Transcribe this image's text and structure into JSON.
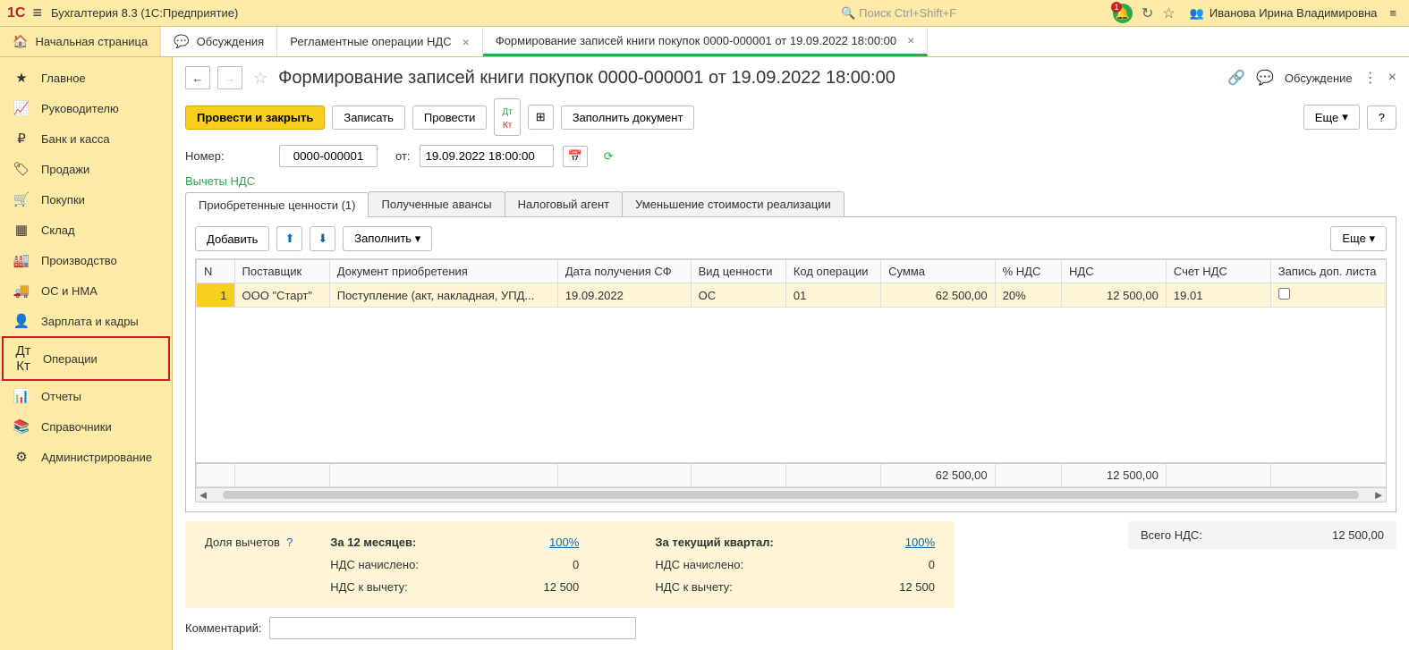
{
  "app": {
    "title": "Бухгалтерия 8.3  (1С:Предприятие)",
    "search_placeholder": "Поиск Ctrl+Shift+F",
    "notif_count": "1",
    "user_name": "Иванова Ирина Владимировна"
  },
  "tabs": {
    "home": "Начальная страница",
    "t1": "Обсуждения",
    "t2": "Регламентные операции НДС",
    "t3": "Формирование записей книги покупок 0000-000001 от 19.09.2022 18:00:00"
  },
  "sidebar": [
    {
      "label": "Главное",
      "icon": "★"
    },
    {
      "label": "Руководителю",
      "icon": "📈"
    },
    {
      "label": "Банк и касса",
      "icon": "₽"
    },
    {
      "label": "Продажи",
      "icon": "🏷"
    },
    {
      "label": "Покупки",
      "icon": "🛒"
    },
    {
      "label": "Склад",
      "icon": "▦"
    },
    {
      "label": "Производство",
      "icon": "🏭"
    },
    {
      "label": "ОС и НМА",
      "icon": "🚚"
    },
    {
      "label": "Зарплата и кадры",
      "icon": "👤"
    },
    {
      "label": "Операции",
      "icon": "Дт Кт",
      "hl": true
    },
    {
      "label": "Отчеты",
      "icon": "📊"
    },
    {
      "label": "Справочники",
      "icon": "📚"
    },
    {
      "label": "Администрирование",
      "icon": "⚙"
    }
  ],
  "page": {
    "title": "Формирование записей книги покупок 0000-000001 от 19.09.2022 18:00:00",
    "discuss_label": "Обсуждение"
  },
  "toolbar": {
    "post_close": "Провести и закрыть",
    "save": "Записать",
    "post": "Провести",
    "fill_doc": "Заполнить документ",
    "more": "Еще",
    "help": "?"
  },
  "form": {
    "number_label": "Номер:",
    "number_value": "0000-000001",
    "from_label": "от:",
    "date_value": "19.09.2022 18:00:00",
    "section_label": "Вычеты НДС"
  },
  "innertabs": {
    "t1": "Приобретенные ценности (1)",
    "t2": "Полученные авансы",
    "t3": "Налоговый агент",
    "t4": "Уменьшение стоимости реализации"
  },
  "tabtoolbar": {
    "add": "Добавить",
    "fill": "Заполнить",
    "more": "Еще"
  },
  "table": {
    "headers": {
      "n": "N",
      "supplier": "Поставщик",
      "doc": "Документ приобретения",
      "sf_date": "Дата получения СФ",
      "value_type": "Вид ценности",
      "op_code": "Код операции",
      "sum": "Сумма",
      "vat_pct": "% НДС",
      "vat": "НДС",
      "vat_acc": "Счет НДС",
      "extra": "Запись доп. листа"
    },
    "rows": [
      {
        "n": "1",
        "supplier": "ООО \"Старт\"",
        "doc": "Поступление (акт, накладная, УПД...",
        "sf_date": "19.09.2022",
        "value_type": "ОС",
        "op_code": "01",
        "sum": "62 500,00",
        "vat_pct": "20%",
        "vat": "12 500,00",
        "vat_acc": "19.01",
        "extra": false
      }
    ],
    "totals": {
      "sum": "62 500,00",
      "vat": "12 500,00"
    }
  },
  "deduct": {
    "title": "Доля вычетов",
    "q": "?",
    "col12_label": "За 12 месяцев:",
    "col12_pct": "100%",
    "colq_label": "За текущий квартал:",
    "colq_pct": "100%",
    "accrued_label": "НДС начислено:",
    "accrued_12": "0",
    "accrued_q": "0",
    "deduct_label": "НДС к вычету:",
    "deduct_12": "12 500",
    "deduct_q": "12 500"
  },
  "totalvat": {
    "label": "Всего НДС:",
    "value": "12 500,00"
  },
  "comment": {
    "label": "Комментарий:",
    "value": ""
  }
}
